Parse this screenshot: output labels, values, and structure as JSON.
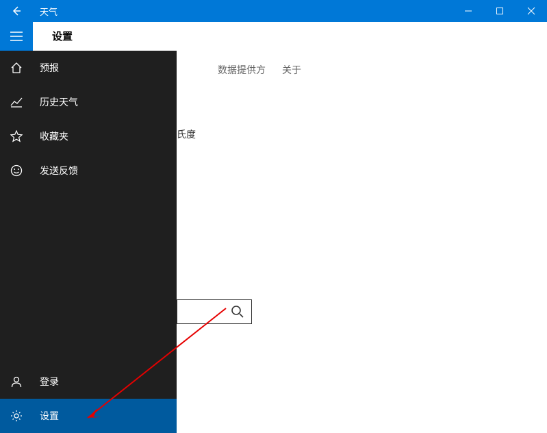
{
  "titlebar": {
    "title": "天气"
  },
  "subheader": {
    "title": "设置"
  },
  "content": {
    "tabs": [
      "数据提供方",
      "关于"
    ],
    "visible_partial_text": "氏度"
  },
  "sidebar": {
    "items": [
      {
        "label": "预报"
      },
      {
        "label": "历史天气"
      },
      {
        "label": "收藏夹"
      },
      {
        "label": "发送反馈"
      }
    ],
    "bottom": [
      {
        "label": "登录"
      },
      {
        "label": "设置"
      }
    ]
  }
}
